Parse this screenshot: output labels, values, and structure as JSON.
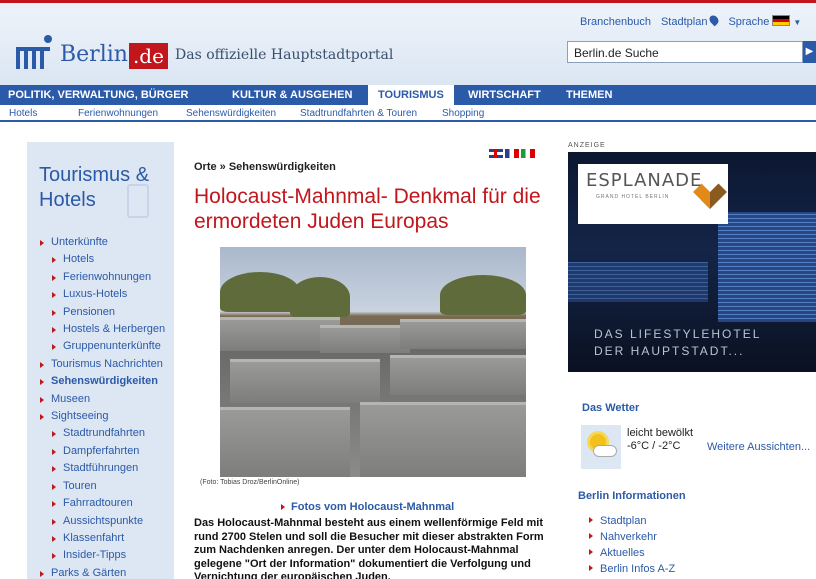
{
  "header": {
    "logo_text": "Berlin",
    "logo_suffix": ".de",
    "tagline": "Das offizielle Hauptstadtportal",
    "links": {
      "branchenbuch": "Branchenbuch",
      "stadtplan": "Stadtplan",
      "sprache": "Sprache"
    },
    "search_value": "Berlin.de Suche"
  },
  "main_nav": [
    "POLITIK, VERWALTUNG, BÜRGER",
    "KULTUR & AUSGEHEN",
    "TOURISMUS",
    "WIRTSCHAFT",
    "THEMEN"
  ],
  "active_main_nav": "TOURISMUS",
  "sub_nav": [
    "Hotels",
    "Ferienwohnungen",
    "Sehenswürdigkeiten",
    "Stadtrundfahrten & Touren",
    "Shopping"
  ],
  "sidebar": {
    "title": "Tourismus & Hotels",
    "items": [
      {
        "label": "Unterkünfte",
        "level": 1
      },
      {
        "label": "Hotels",
        "level": 2
      },
      {
        "label": "Ferienwohnungen",
        "level": 2
      },
      {
        "label": "Luxus-Hotels",
        "level": 2
      },
      {
        "label": "Pensionen",
        "level": 2
      },
      {
        "label": "Hostels & Herbergen",
        "level": 2
      },
      {
        "label": "Gruppenunterkünfte",
        "level": 2
      },
      {
        "label": "Tourismus Nachrichten",
        "level": 1
      },
      {
        "label": "Sehenswürdigkeiten",
        "level": 1,
        "bold": true
      },
      {
        "label": "Museen",
        "level": 1
      },
      {
        "label": "Sightseeing",
        "level": 1
      },
      {
        "label": "Stadtrundfahrten",
        "level": 2
      },
      {
        "label": "Dampferfahrten",
        "level": 2
      },
      {
        "label": "Stadtführungen",
        "level": 2
      },
      {
        "label": "Touren",
        "level": 2
      },
      {
        "label": "Fahrradtouren",
        "level": 2
      },
      {
        "label": "Aussichtspunkte",
        "level": 2
      },
      {
        "label": "Klassenfahrt",
        "level": 2
      },
      {
        "label": "Insider-Tipps",
        "level": 2
      },
      {
        "label": "Parks & Gärten",
        "level": 1
      }
    ]
  },
  "article": {
    "breadcrumb": "Orte » Sehenswürdigkeiten",
    "title": "Holocaust-Mahnmal- Denkmal für die ermordeten Juden Europas",
    "photo_caption": "(Foto: Tobias Droz/BerlinOnline)",
    "photo_link": "Fotos vom Holocaust-Mahnmal",
    "body": "Das Holocaust-Mahnmal besteht aus einem wellenförmige Feld mit rund 2700 Stelen und soll die Besucher mit dieser abstrakten Form zum Nachdenken anregen. Der unter dem Holocaust-Mahnmal gelegene \"Ort der Information\" dokumentiert die Verfolgung und Vernichtung der europäischen Juden."
  },
  "ad": {
    "label": "ANZEIGE",
    "brand": "ESPLANADE",
    "brand_sub": "GRAND HOTEL BERLIN",
    "tagline_line1": "DAS LIFESTYLEHOTEL",
    "tagline_line2": "DER HAUPTSTADT..."
  },
  "weather": {
    "title": "Das Wetter",
    "condition": "leicht bewölkt",
    "temps": "-6°C / -2°C",
    "more_link": "Weitere Aussichten..."
  },
  "berlin_info": {
    "title": "Berlin Informationen",
    "items": [
      "Stadtplan",
      "Nahverkehr",
      "Aktuelles",
      "Berlin Infos A-Z"
    ]
  },
  "colors": {
    "brand_blue": "#2b5aa8",
    "brand_red": "#c2161d",
    "sidebar_bg": "#dde6f3"
  }
}
